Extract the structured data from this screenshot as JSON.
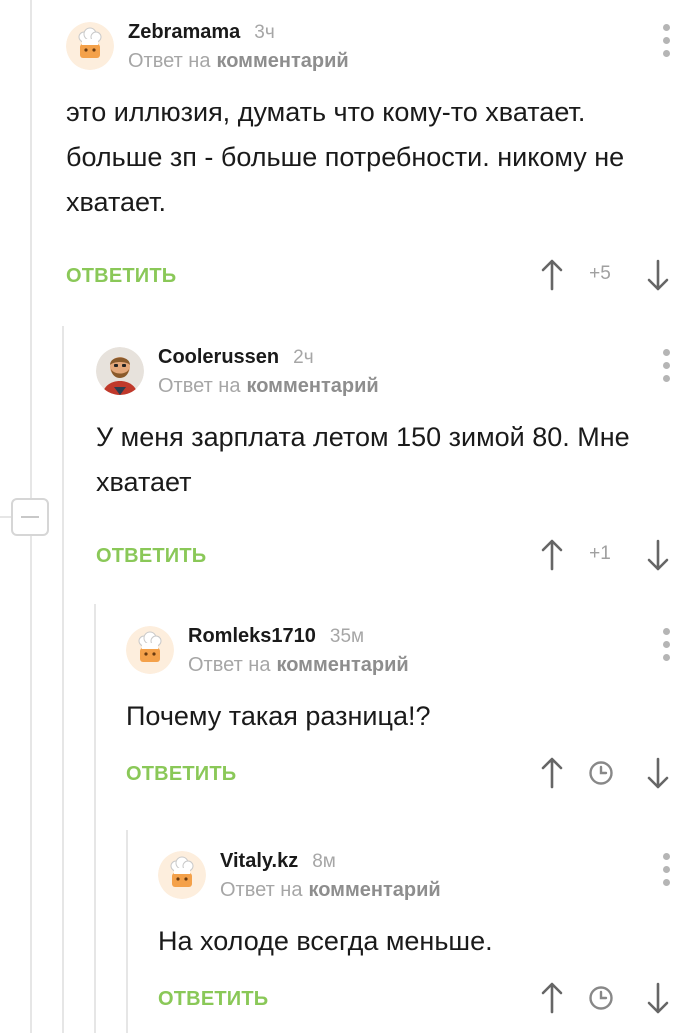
{
  "comments": [
    {
      "username": "Zebramama",
      "time": "3ч",
      "reply_prefix": "Ответ на",
      "reply_link": "комментарий",
      "text": "это иллюзия, думать что кому-то хватает. больше зп - больше потребности. никому не хватает.",
      "reply_label": "ОТВЕТИТЬ",
      "score": "+5",
      "avatar_icon": "default-chef-avatar"
    },
    {
      "username": "Coolerussen",
      "time": "2ч",
      "reply_prefix": "Ответ на",
      "reply_link": "комментарий",
      "text": "У меня зарплата летом 150 зимой 80. Мне хватает",
      "reply_label": "ОТВЕТИТЬ",
      "score": "+1",
      "avatar_icon": "bearded-man-avatar"
    },
    {
      "username": "Romleks1710",
      "time": "35м",
      "reply_prefix": "Ответ на",
      "reply_link": "комментарий",
      "text": "Почему такая разница!?",
      "reply_label": "ОТВЕТИТЬ",
      "score_icon": "clock-icon",
      "avatar_icon": "default-chef-avatar"
    },
    {
      "username": "Vitaly.kz",
      "time": "8м",
      "reply_prefix": "Ответ на",
      "reply_link": "комментарий",
      "text": "На холоде всегда меньше.",
      "reply_label": "ОТВЕТИТЬ",
      "score_icon": "clock-icon",
      "avatar_icon": "default-chef-avatar"
    }
  ],
  "colors": {
    "accent_green": "#8ac858",
    "muted_text": "#a6a6a6",
    "branch_line": "#e6e6e6"
  }
}
